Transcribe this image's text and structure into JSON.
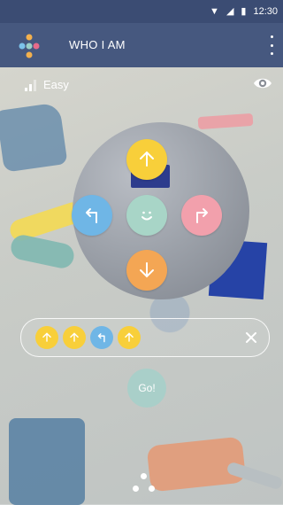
{
  "status_bar": {
    "time": "12:30"
  },
  "app_bar": {
    "title": "WHO I AM"
  },
  "level": {
    "label": "Easy"
  },
  "dpad": {
    "center_color": "#a8d5c7",
    "up": {
      "color": "#f8cf3a",
      "icon": "arrow-up-icon"
    },
    "left": {
      "color": "#6fb6e6",
      "icon": "turn-left-icon"
    },
    "right": {
      "color": "#f2a0ac",
      "icon": "turn-right-icon"
    },
    "down": {
      "color": "#f4a654",
      "icon": "arrow-down-icon"
    }
  },
  "sequence": {
    "steps": [
      {
        "icon": "arrow-up-icon",
        "color": "#f8cf3a"
      },
      {
        "icon": "arrow-up-icon",
        "color": "#f8cf3a"
      },
      {
        "icon": "turn-left-icon",
        "color": "#6fb6e6"
      },
      {
        "icon": "arrow-up-icon",
        "color": "#f8cf3a"
      }
    ]
  },
  "go_button": {
    "label": "Go!"
  },
  "colors": {
    "status_bar": "#3b4c73",
    "app_bar": "#46587f"
  }
}
